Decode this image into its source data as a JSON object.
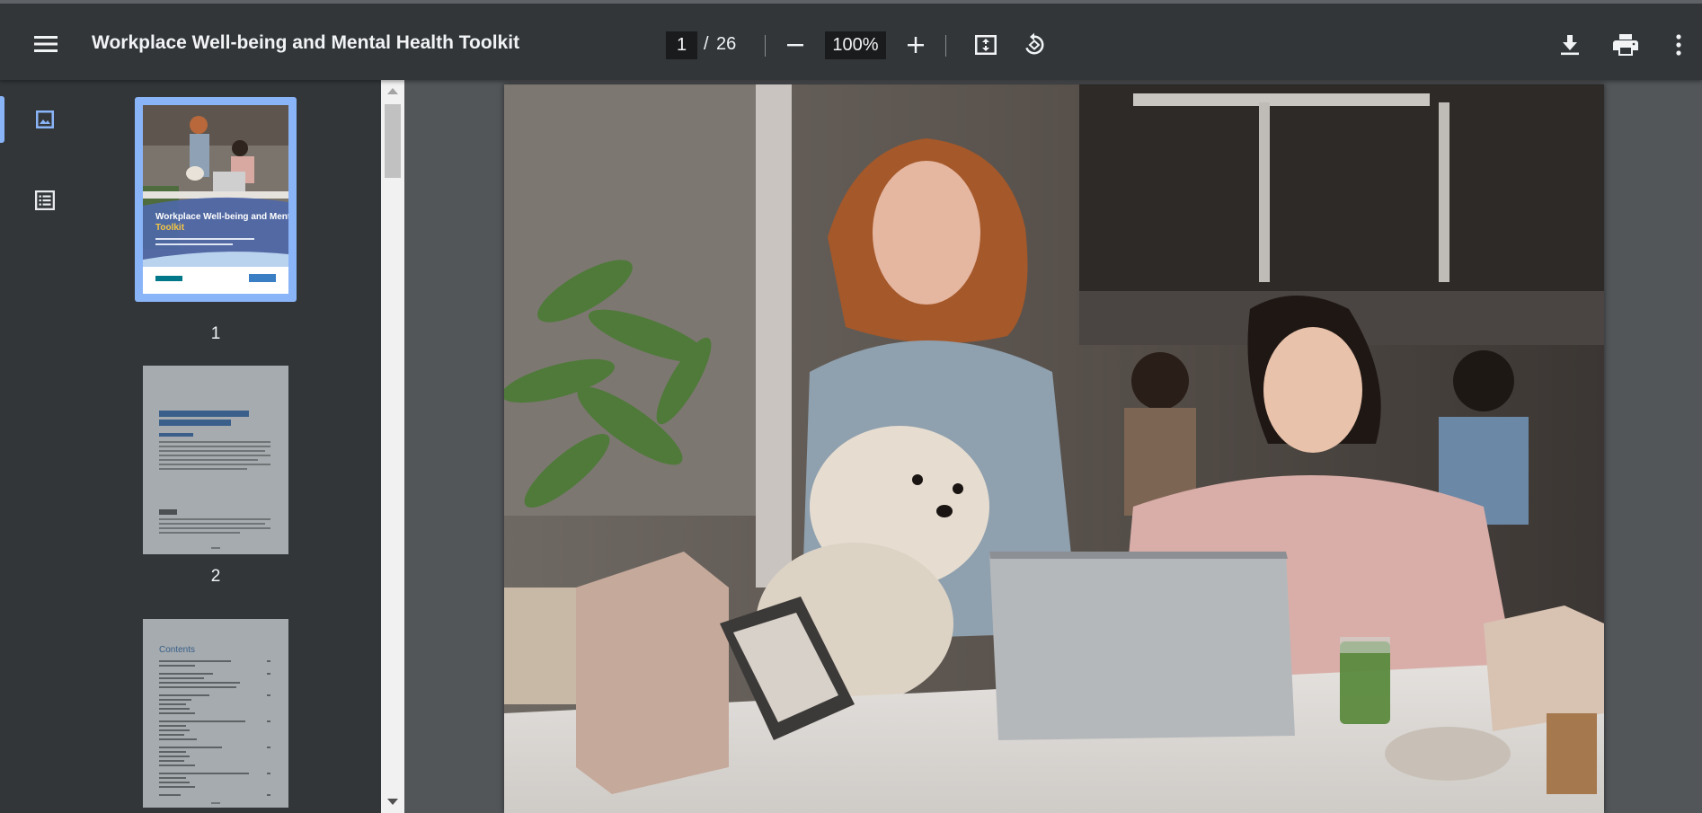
{
  "toolbar": {
    "menu_icon": "hamburger-menu-icon",
    "title": "Workplace Well-being and Mental Health Toolkit",
    "current_page": "1",
    "page_separator": "/",
    "total_pages": "26",
    "zoom": "100%",
    "zoom_out_icon": "minus-icon",
    "zoom_in_icon": "plus-icon",
    "fit_icon": "fit-to-page-icon",
    "rotate_icon": "rotate-counterclockwise-icon",
    "download_icon": "download-icon",
    "print_icon": "print-icon",
    "more_icon": "more-vertical-icon"
  },
  "sidebar": {
    "thumbnails_icon": "image-icon",
    "outline_icon": "list-icon"
  },
  "thumbnails": [
    {
      "page": "1",
      "cover_title": "Workplace Well-being and Mental Health",
      "cover_title_accent": "Toolkit",
      "cover_subtitle": "A tool to improve the psychosocial environment in the workplace",
      "left_logo": "Alberta Health Services",
      "right_logo": "HEALTHIER TOGETHER"
    },
    {
      "page": "2",
      "heading": "Workplace Well-being and Mental Health Toolkit",
      "subheading": "About the Toolkit"
    },
    {
      "page": "3",
      "heading": "Contents"
    }
  ],
  "colors": {
    "toolbar_bg": "#323639",
    "viewer_bg": "#525659",
    "accent": "#8ab4f8"
  }
}
